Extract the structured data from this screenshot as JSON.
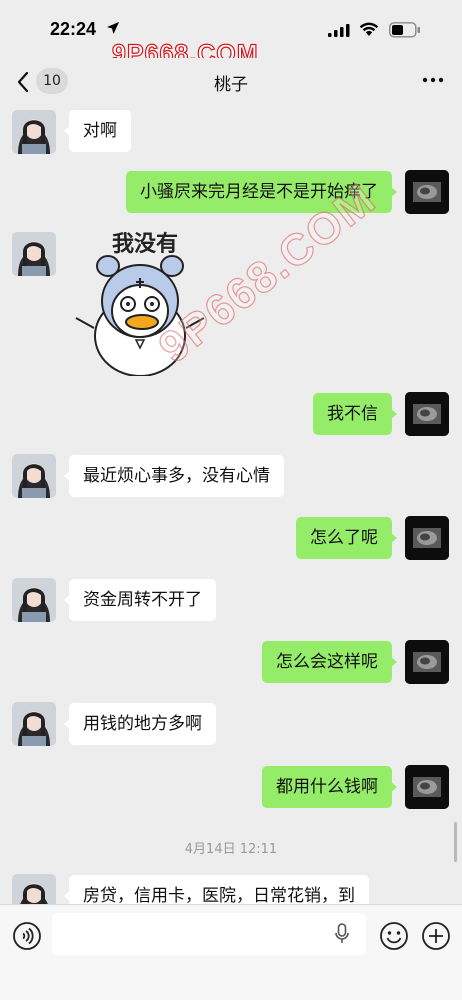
{
  "status_bar": {
    "time": "22:24"
  },
  "watermark": {
    "top": "9P668.COM",
    "diagonal": "9P668.COM"
  },
  "nav": {
    "back_count": "10",
    "title": "桃子",
    "more_icon": "more-icon"
  },
  "messages": [
    {
      "side": "left",
      "type": "text",
      "text": "对啊"
    },
    {
      "side": "right",
      "type": "text",
      "text": "小骚屄来完月经是不是开始痒了"
    },
    {
      "side": "left",
      "type": "sticker",
      "text": "我没有"
    },
    {
      "side": "right",
      "type": "text",
      "text": "我不信"
    },
    {
      "side": "left",
      "type": "text",
      "text": "最近烦心事多，没有心情"
    },
    {
      "side": "right",
      "type": "text",
      "text": "怎么了呢"
    },
    {
      "side": "left",
      "type": "text",
      "text": "资金周转不开了"
    },
    {
      "side": "right",
      "type": "text",
      "text": "怎么会这样呢"
    },
    {
      "side": "left",
      "type": "text",
      "text": "用钱的地方多啊"
    },
    {
      "side": "right",
      "type": "text",
      "text": "都用什么钱啊"
    },
    {
      "side": "left",
      "type": "text",
      "text": "房贷，信用卡，医院，日常花销，到"
    }
  ],
  "timestamp": "4月14日 12:11",
  "input_bar": {
    "voice_icon": "voice-icon",
    "mic_icon": "mic-icon",
    "emoji_icon": "emoji-icon",
    "plus_icon": "plus-icon",
    "input_value": ""
  },
  "colors": {
    "background": "#ededed",
    "bubble_right": "#95ec69",
    "bubble_left": "#ffffff",
    "watermark": "#d4161d"
  }
}
